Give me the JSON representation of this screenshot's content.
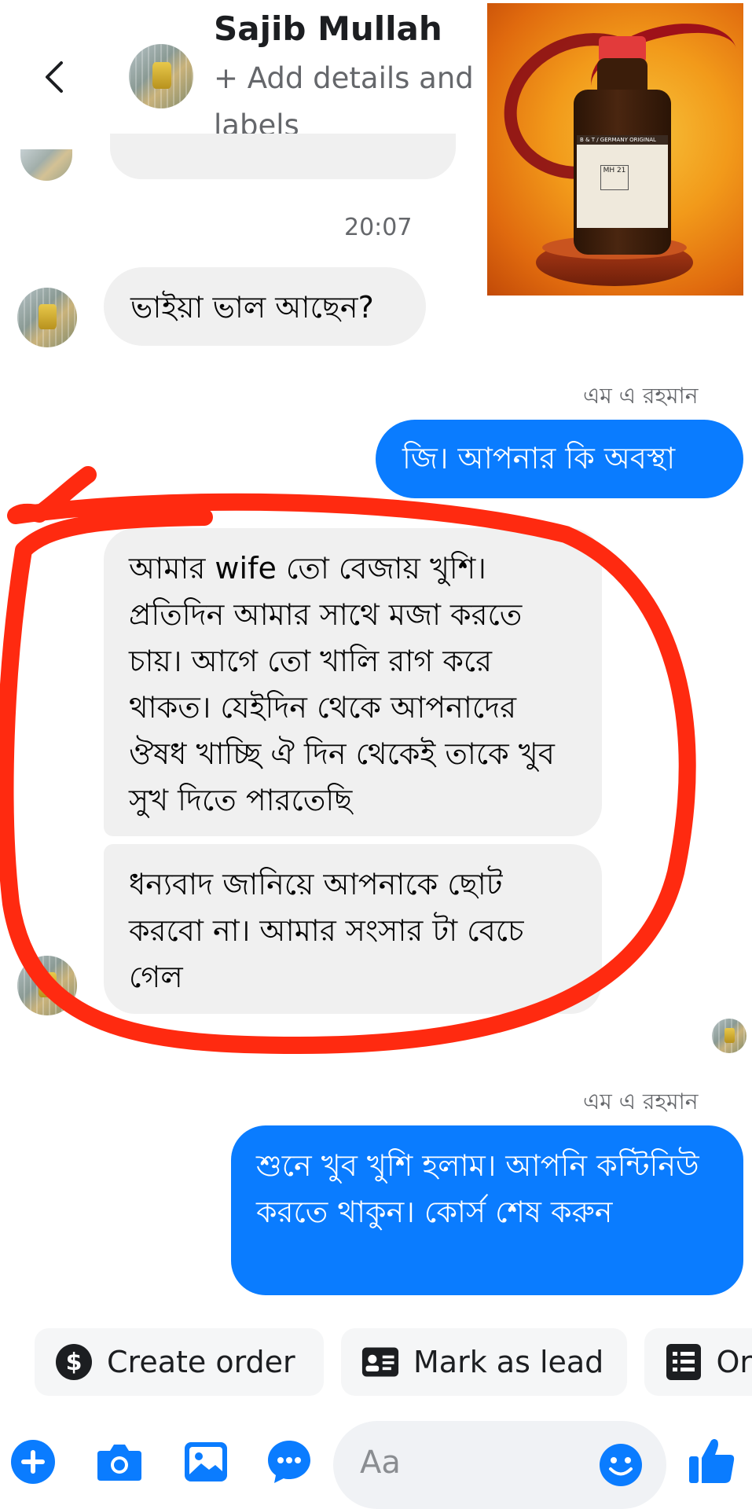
{
  "header": {
    "name": "Sajib Mullah",
    "subtitle": "+ Add details and labels"
  },
  "product_image": {
    "label_brand": "B & T / GERMANY ORIGINAL",
    "label_code": "MH 21"
  },
  "conversation": {
    "timestamp": "20:07",
    "messages": [
      {
        "direction": "incoming",
        "text": "ভাইয়া ভাল আছেন?"
      },
      {
        "direction": "outgoing",
        "sender": "এম এ রহমান",
        "text": "জি। আপনার কি অবস্থা"
      },
      {
        "direction": "incoming",
        "text": "আমার wife তো বেজায় খুশি। প্রতিদিন আমার সাথে মজা করতে চায়। আগে তো খালি রাগ করে থাকত। যেইদিন থেকে আপনাদের ঔষধ খাচ্ছি ঐ দিন থেকেই তাকে খুব সুখ দিতে পারতেছি"
      },
      {
        "direction": "incoming",
        "text": "ধন্যবাদ জানিয়ে আপনাকে ছোট করবো না। আমার সংসার টা বেচে গেল"
      },
      {
        "direction": "outgoing",
        "sender": "এম এ রহমান",
        "text": "শুনে খুব খুশি হলাম। আপনি কন্টিনিউ করতে থাকুন। কোর্স শেষ করুন"
      }
    ]
  },
  "quick_actions": [
    {
      "label": "Create order",
      "icon": "dollar-circle-icon"
    },
    {
      "label": "Mark as lead",
      "icon": "contact-card-icon"
    },
    {
      "label": "Or",
      "icon": "list-icon"
    }
  ],
  "composer": {
    "placeholder": "Aa",
    "icons": [
      "plus-circle-icon",
      "camera-icon",
      "gallery-icon",
      "chat-bubble-icon",
      "emoji-icon",
      "thumbs-up-icon"
    ]
  },
  "colors": {
    "accent": "#0a7cff",
    "annotation_red": "#ff2a10",
    "incoming_bubble": "#f0f0f0"
  }
}
